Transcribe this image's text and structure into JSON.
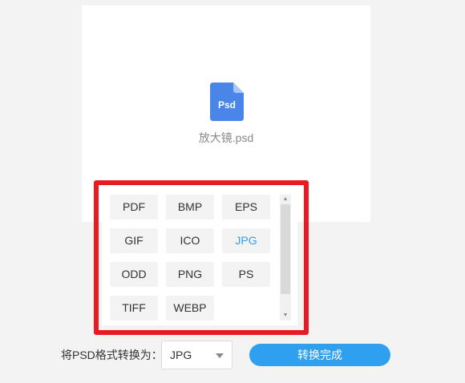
{
  "file": {
    "icon_label": "Psd",
    "name": "放大镜.psd",
    "icon_color": "#4a86e8"
  },
  "format_menu": {
    "options": [
      "PDF",
      "BMP",
      "EPS",
      "GIF",
      "ICO",
      "JPG",
      "ODD",
      "PNG",
      "PS",
      "TIFF",
      "WEBP"
    ],
    "selected": "JPG",
    "selected_color": "#2f9ff0",
    "highlight_color": "#e81b23"
  },
  "convert": {
    "label": "将PSD格式转换为：",
    "selected_format": "JPG",
    "button_label": "转换完成",
    "button_color": "#2f9ff0"
  }
}
